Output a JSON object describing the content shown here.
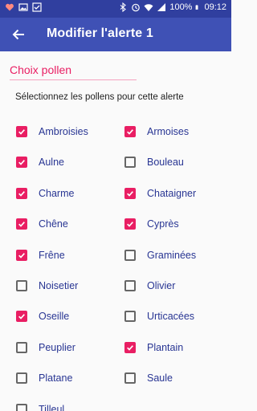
{
  "status_bar": {
    "battery": "100%",
    "time": "09:12",
    "icons": [
      "heart-icon",
      "image-icon",
      "check-box-icon",
      "bluetooth-icon",
      "alarm-icon",
      "wifi-icon",
      "signal-icon",
      "battery-icon"
    ]
  },
  "app_bar": {
    "title": "Modifier l'alerte 1",
    "back_icon": "arrow-left-icon"
  },
  "section": {
    "label": "Choix pollen",
    "instructions": "Sélectionnez les pollens pour cette alerte"
  },
  "pollens": [
    {
      "label": "Ambroisies",
      "checked": true
    },
    {
      "label": "Armoises",
      "checked": true
    },
    {
      "label": "Aulne",
      "checked": true
    },
    {
      "label": "Bouleau",
      "checked": false
    },
    {
      "label": "Charme",
      "checked": true
    },
    {
      "label": "Chataigner",
      "checked": true
    },
    {
      "label": "Chêne",
      "checked": true
    },
    {
      "label": "Cyprès",
      "checked": true
    },
    {
      "label": "Frêne",
      "checked": true
    },
    {
      "label": "Graminées",
      "checked": false
    },
    {
      "label": "Noisetier",
      "checked": false
    },
    {
      "label": "Olivier",
      "checked": false
    },
    {
      "label": "Oseille",
      "checked": true
    },
    {
      "label": "Urticacées",
      "checked": false
    },
    {
      "label": "Peuplier",
      "checked": false
    },
    {
      "label": "Plantain",
      "checked": true
    },
    {
      "label": "Platane",
      "checked": false
    },
    {
      "label": "Saule",
      "checked": false
    },
    {
      "label": "Tilleul",
      "checked": false
    }
  ],
  "colors": {
    "primary": "#3f51b5",
    "primary_dark": "#303f9f",
    "accent": "#e91e63",
    "label_text": "#283593"
  }
}
